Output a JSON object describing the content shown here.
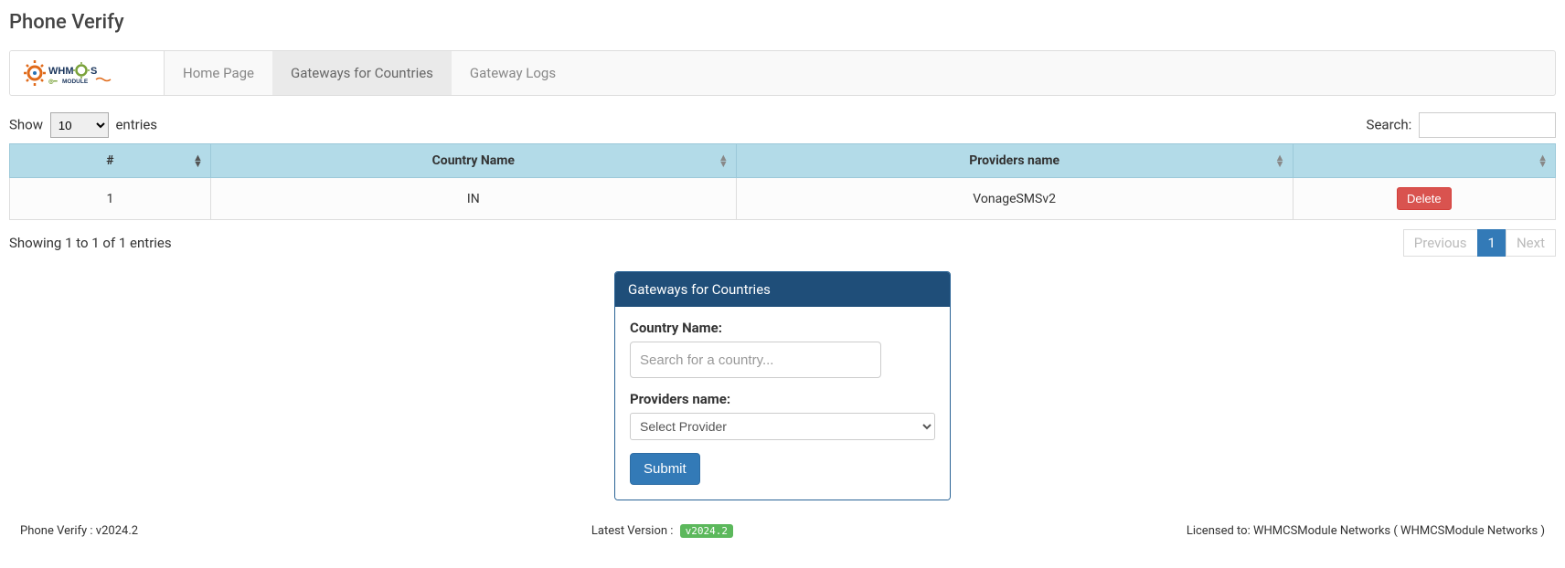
{
  "page": {
    "title": "Phone Verify"
  },
  "tabs": {
    "home": "Home Page",
    "gateways": "Gateways for Countries",
    "logs": "Gateway Logs"
  },
  "table_controls": {
    "show_label_pre": "Show",
    "show_label_post": "entries",
    "length_value": "10",
    "search_label": "Search:"
  },
  "columns": {
    "idx": "#",
    "country": "Country Name",
    "provider": "Providers name",
    "actions": ""
  },
  "rows": [
    {
      "idx": "1",
      "country": "IN",
      "provider": "VonageSMSv2",
      "delete_label": "Delete"
    }
  ],
  "info_text": "Showing 1 to 1 of 1 entries",
  "pagination": {
    "prev": "Previous",
    "page1": "1",
    "next": "Next"
  },
  "panel": {
    "title": "Gateways for Countries",
    "country_label": "Country Name:",
    "country_placeholder": "Search for a country...",
    "provider_label": "Providers name:",
    "provider_selected": "Select Provider",
    "submit": "Submit"
  },
  "footer": {
    "left": "Phone Verify : v2024.2",
    "center_label": "Latest Version : ",
    "center_badge": "v2024.2",
    "right": "Licensed to: WHMCSModule Networks ( WHMCSModule Networks )"
  }
}
